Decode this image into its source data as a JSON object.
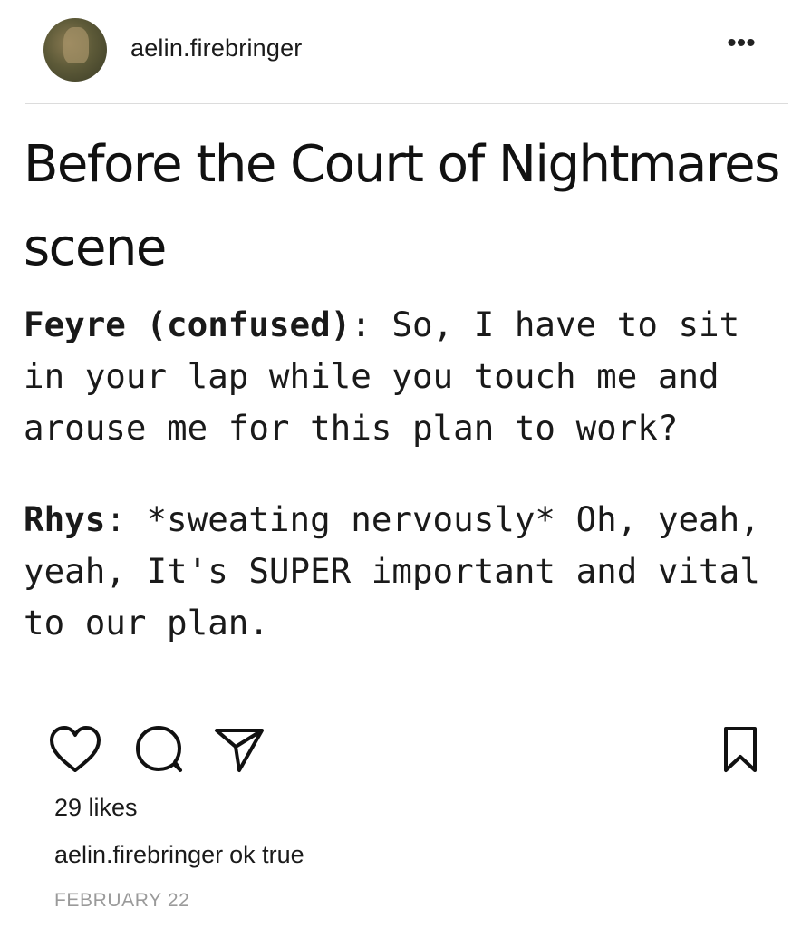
{
  "header": {
    "username": "aelin.firebringer",
    "more_label": "•••"
  },
  "post": {
    "title": "Before the Court of Nightmares scene",
    "dialogue": [
      {
        "speaker": "Feyre (confused)",
        "separator": ": ",
        "text": "So, I have to sit in your lap while you touch me and arouse me for this plan to work?"
      },
      {
        "speaker": "Rhys",
        "separator": ": ",
        "text": "*sweating nervously* Oh, yeah, yeah, It's SUPER important and vital to our plan."
      }
    ]
  },
  "actions": {
    "icons": [
      "heart-icon",
      "comment-icon",
      "share-icon",
      "bookmark-icon"
    ]
  },
  "likes": "29 likes",
  "caption": {
    "username": "aelin.firebringer",
    "text": "ok true"
  },
  "date": "FEBRUARY 22"
}
